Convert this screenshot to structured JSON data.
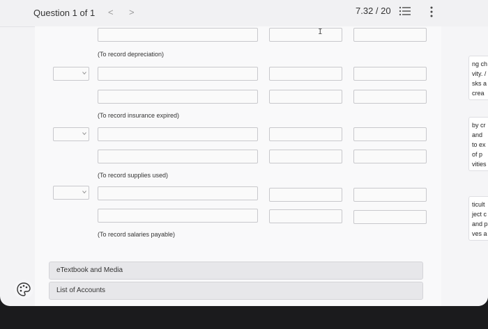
{
  "header": {
    "question_label": "Question 1 of 1",
    "prev_icon": "<",
    "next_icon": ">",
    "score": "7.32 / 20"
  },
  "journal": {
    "captions": [
      "(To record depreciation)",
      "(To record insurance expired)",
      "(To record supplies used)",
      "(To record salaries payable)"
    ]
  },
  "resources": {
    "etextbook_label": "eTextbook and Media",
    "accounts_label": "List of Accounts"
  },
  "side_text": {
    "block1": [
      "ng ch",
      "vity. /",
      "sks a",
      "crea"
    ],
    "block2": [
      "by cr",
      "and",
      "to ex",
      "of p",
      "vities"
    ],
    "block3": [
      "ticult",
      "ject c",
      "and p",
      "ves a"
    ]
  },
  "colors": {
    "background": "#f3f3f5",
    "panel": "#e7e7ea",
    "field_border": "#c8c8cc",
    "bezel": "#1b1b1d"
  }
}
